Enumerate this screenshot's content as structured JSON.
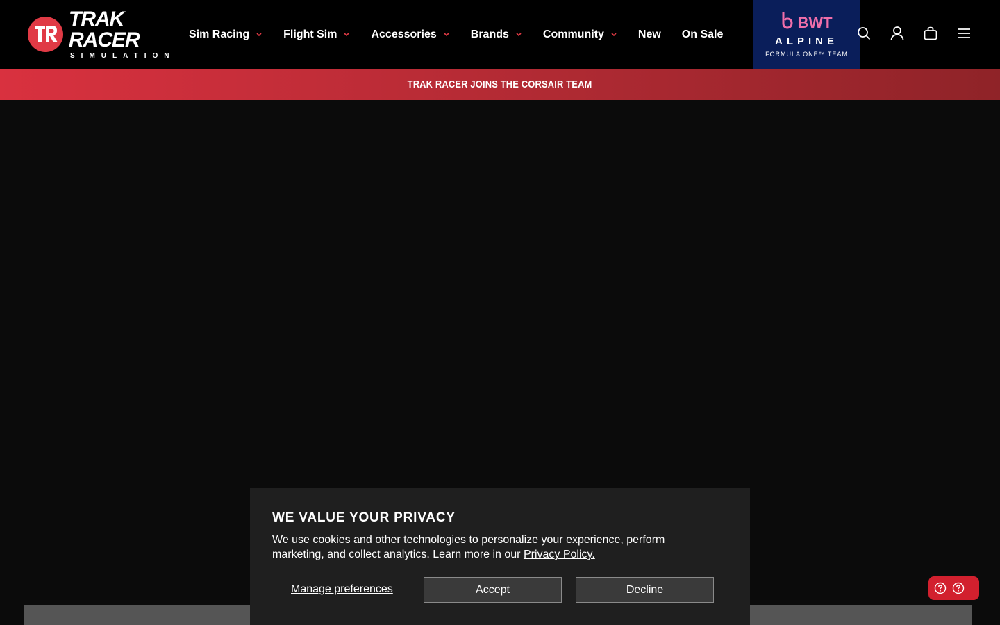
{
  "logo": {
    "main": "TRAK RACER",
    "sub": "SIMULATION"
  },
  "nav": {
    "items": [
      {
        "label": "Sim Racing",
        "has_dropdown": true
      },
      {
        "label": "Flight Sim",
        "has_dropdown": true
      },
      {
        "label": "Accessories",
        "has_dropdown": true
      },
      {
        "label": "Brands",
        "has_dropdown": true
      },
      {
        "label": "Community",
        "has_dropdown": true
      },
      {
        "label": "New",
        "has_dropdown": false
      },
      {
        "label": "On Sale",
        "has_dropdown": false
      }
    ]
  },
  "partner": {
    "bwt": "BWT",
    "alpine": "ALPINE",
    "f1": "FORMULA ONE™ TEAM"
  },
  "header_icons": [
    "search-icon",
    "account-icon",
    "cart-icon",
    "menu-icon"
  ],
  "banner": {
    "text": "TRAK RACER JOINS THE CORSAIR TEAM"
  },
  "cookie": {
    "title": "WE VALUE YOUR PRIVACY",
    "body": "We use cookies and other technologies to personalize your experience, perform marketing, and collect analytics. Learn more in our ",
    "link": "Privacy Policy.",
    "manage": "Manage preferences",
    "accept": "Accept",
    "decline": "Decline"
  },
  "help_icons": [
    "help-icon",
    "help-icon"
  ],
  "colors": {
    "accent": "#e03a45",
    "partner_bg": "#0a1e5a",
    "partner_pink": "#f06eaa",
    "help_bg": "#d2202e"
  }
}
